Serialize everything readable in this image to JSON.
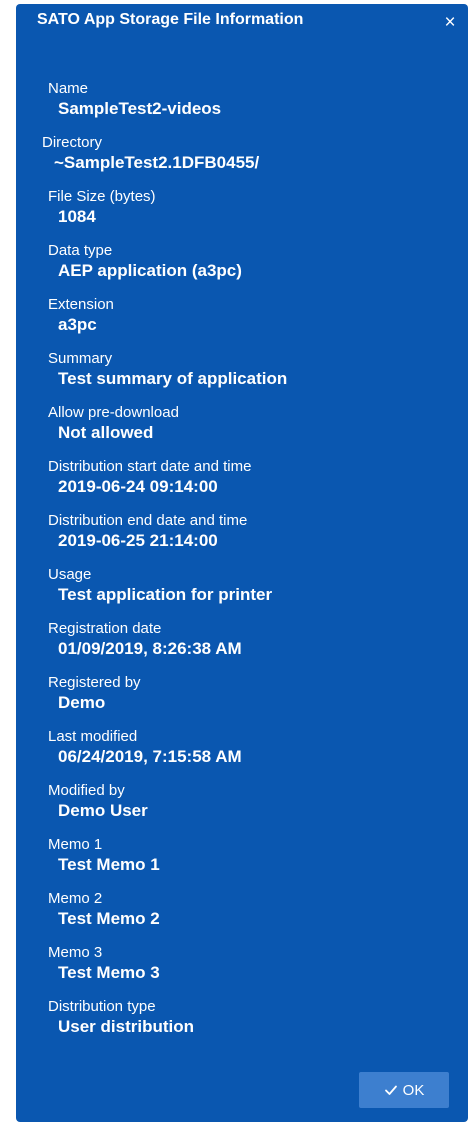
{
  "dialog": {
    "title": "SATO App Storage File Information",
    "close_symbol": "×",
    "ok_label": "OK"
  },
  "fields": [
    {
      "label": "Name",
      "value": "SampleTest2-videos"
    },
    {
      "label": "Directory",
      "value": "~SampleTest2.1DFB0455/"
    },
    {
      "label": "File Size (bytes)",
      "value": "1084"
    },
    {
      "label": "Data type",
      "value": "AEP application (a3pc)"
    },
    {
      "label": "Extension",
      "value": "a3pc"
    },
    {
      "label": "Summary",
      "value": "Test summary of application"
    },
    {
      "label": "Allow pre-download",
      "value": "Not allowed"
    },
    {
      "label": "Distribution start date and time",
      "value": "2019-06-24 09:14:00"
    },
    {
      "label": "Distribution end date and time",
      "value": "2019-06-25 21:14:00"
    },
    {
      "label": "Usage",
      "value": "Test application for printer"
    },
    {
      "label": "Registration date",
      "value": "01/09/2019, 8:26:38 AM"
    },
    {
      "label": "Registered by",
      "value": "Demo"
    },
    {
      "label": "Last modified",
      "value": "06/24/2019, 7:15:58 AM"
    },
    {
      "label": "Modified by",
      "value": "Demo User"
    },
    {
      "label": "Memo 1",
      "value": "Test Memo 1"
    },
    {
      "label": "Memo 2",
      "value": "Test Memo 2"
    },
    {
      "label": "Memo 3",
      "value": "Test Memo 3"
    },
    {
      "label": "Distribution type",
      "value": "User distribution"
    }
  ],
  "colors": {
    "dialog_background": "#0a57b0",
    "ok_button_background": "#3d7fcf",
    "text": "#ffffff"
  },
  "icons": {
    "close": "close-icon",
    "ok": "checkmark-icon"
  }
}
